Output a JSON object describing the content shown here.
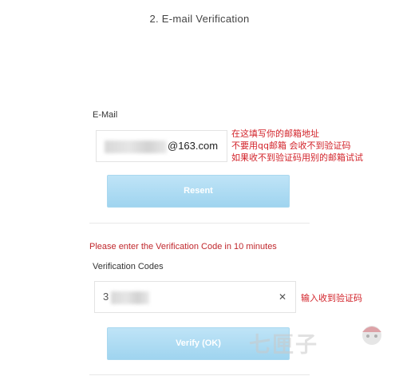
{
  "page": {
    "title": "2. E-mail Verification"
  },
  "email_section": {
    "label": "E-Mail",
    "value_suffix": "@163.com",
    "resend_label": "Resent"
  },
  "annotation_email": {
    "line1": "在这填写你的邮箱地址",
    "line2": "不要用qq邮箱 会收不到验证码",
    "line3": "如果收不到验证码用别的邮箱试试"
  },
  "verification": {
    "notice": "Please enter the Verification Code in 10 minutes",
    "label": "Verification Codes",
    "value_prefix": "3",
    "clear_glyph": "✕",
    "verify_label": "Verify (OK)"
  },
  "annotation_code": {
    "text": "输入收到验证码"
  },
  "watermark": {
    "text": "七匣子"
  },
  "colors": {
    "annotation": "#d2232a",
    "button": "#a9d8ef"
  }
}
